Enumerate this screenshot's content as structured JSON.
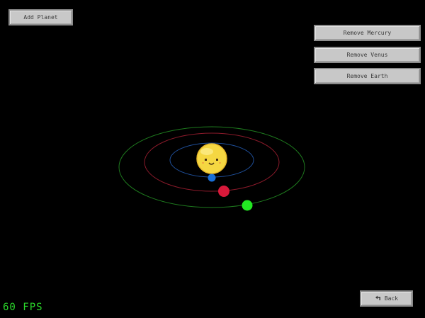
{
  "toolbar": {
    "add_planet_label": "Add Planet"
  },
  "remove_buttons": [
    {
      "label": "Remove Mercury"
    },
    {
      "label": "Remove Venus"
    },
    {
      "label": "Remove Earth"
    }
  ],
  "back": {
    "label": "Back",
    "icon": "back-arrow-icon"
  },
  "hud": {
    "fps_text": "60 FPS"
  },
  "colors": {
    "background": "#000000",
    "sun": "#f5d742",
    "mercury": "#1a6fd6",
    "venus": "#d8193a",
    "earth": "#22e822",
    "mercury_orbit": "#1f4f9a",
    "venus_orbit": "#8a1a2a",
    "earth_orbit": "#1e7a1e",
    "fps": "#2bd92b"
  }
}
